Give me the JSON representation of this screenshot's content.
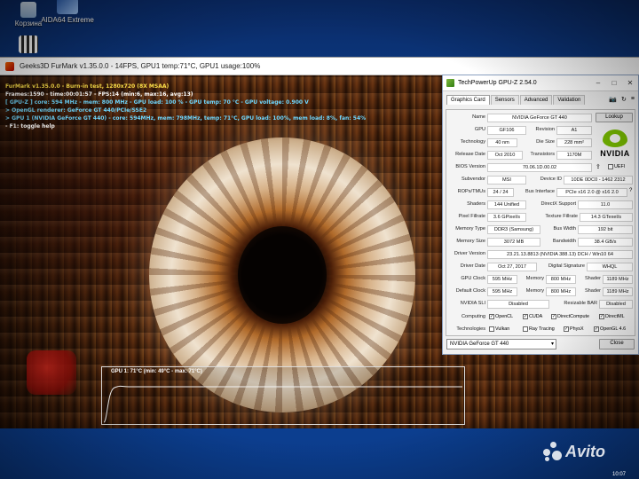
{
  "desktop": {
    "icons": [
      {
        "label": "Корзина"
      },
      {
        "label": "AIDA64 Extreme"
      },
      {
        "label": ""
      }
    ],
    "clock": "10:07"
  },
  "furmark": {
    "window_title": "Geeks3D FurMark v1.35.0.0 - 14FPS, GPU1 temp:71°C, GPU1 usage:100%",
    "osd_lines": [
      {
        "text": "FurMark v1.35.0.0 - Burn-in test, 1280x720 (8X MSAA)",
        "color": "yellow"
      },
      {
        "text": "Frames:1590 - time:00:01:57 - FPS:14 (min:6, max:16, avg:13)",
        "color": "white"
      },
      {
        "text": "[ GPU-Z ] core: 594 MHz - mem: 800 MHz - GPU load: 100 % - GPU temp: 70 °C - GPU voltage: 0.900 V",
        "color": "cyan"
      },
      {
        "text": "> OpenGL renderer: GeForce GT 440/PCIe/SSE2",
        "color": "cyan"
      },
      {
        "text": "> GPU 1 (NVIDIA GeForce GT 440) - core: 594MHz, mem: 798MHz, temp: 71°C, GPU load: 100%, mem load: 8%, fan: 54%",
        "color": "cyan"
      },
      {
        "text": "- F1: toggle help",
        "color": "white"
      }
    ],
    "temp_graph": {
      "label": "GPU 1: 71°C (min: 49°C - max: 71°C)",
      "min": 49,
      "max": 71,
      "current": 71
    }
  },
  "gpuz": {
    "title": "TechPowerUp GPU-Z 2.54.0",
    "tabs": [
      "Graphics Card",
      "Sensors",
      "Advanced",
      "Validation"
    ],
    "lookup_label": "Lookup",
    "vendor_logo": "NVIDIA",
    "uefi_label": "UEFI",
    "fields": {
      "name": {
        "label": "Name",
        "value": "NVIDIA GeForce GT 440"
      },
      "gpu": {
        "label": "GPU",
        "value": "GF106"
      },
      "revision": {
        "label": "Revision",
        "value": "A1"
      },
      "technology": {
        "label": "Technology",
        "value": "40 nm"
      },
      "die_size": {
        "label": "Die Size",
        "value": "228 mm²"
      },
      "release_date": {
        "label": "Release Date",
        "value": "Oct 2010"
      },
      "transistors": {
        "label": "Transistors",
        "value": "1170M"
      },
      "bios_version": {
        "label": "BIOS Version",
        "value": "70.06.1D.00.02"
      },
      "subvendor": {
        "label": "Subvendor",
        "value": "MSI"
      },
      "device_id": {
        "label": "Device ID",
        "value": "10DE 0DC0 - 1462 2312"
      },
      "rops_tmus": {
        "label": "ROPs/TMUs",
        "value": "24 / 24"
      },
      "bus_interface": {
        "label": "Bus Interface",
        "value": "PCIe x16 2.0 @ x16 2.0"
      },
      "shaders": {
        "label": "Shaders",
        "value": "144 Unified"
      },
      "directx_support": {
        "label": "DirectX Support",
        "value": "11.0"
      },
      "pixel_fillrate": {
        "label": "Pixel Fillrate",
        "value": "3.6 GPixel/s"
      },
      "texture_fillrate": {
        "label": "Texture Fillrate",
        "value": "14.3 GTexel/s"
      },
      "memory_type": {
        "label": "Memory Type",
        "value": "DDR3 (Samsung)"
      },
      "bus_width": {
        "label": "Bus Width",
        "value": "192 bit"
      },
      "memory_size": {
        "label": "Memory Size",
        "value": "3072 MB"
      },
      "bandwidth": {
        "label": "Bandwidth",
        "value": "38.4 GB/s"
      },
      "driver_version": {
        "label": "Driver Version",
        "value": "23.21.13.8813 (NVIDIA 388.13) DCH / Win10 64"
      },
      "driver_date": {
        "label": "Driver Date",
        "value": "Oct 27, 2017"
      },
      "digital_signature": {
        "label": "Digital Signature",
        "value": "WHQL"
      },
      "gpu_clock": {
        "label": "GPU Clock",
        "value": "595 MHz"
      },
      "memory_clock": {
        "label": "Memory",
        "value": "800 MHz"
      },
      "shader_clock": {
        "label": "Shader",
        "value": "1189 MHz"
      },
      "default_clock": {
        "label": "Default Clock",
        "value": "595 MHz"
      },
      "default_memory": {
        "label": "Memory",
        "value": "800 MHz"
      },
      "default_shader": {
        "label": "Shader",
        "value": "1189 MHz"
      },
      "nvidia_sli": {
        "label": "NVIDIA SLI",
        "value": "Disabled"
      },
      "resizable_bar": {
        "label": "Resizable BAR",
        "value": "Disabled"
      }
    },
    "computing": {
      "label": "Computing",
      "items": [
        {
          "name": "OpenCL",
          "checked": true
        },
        {
          "name": "CUDA",
          "checked": true
        },
        {
          "name": "DirectCompute",
          "checked": true
        },
        {
          "name": "DirectML",
          "checked": true
        }
      ]
    },
    "technologies": {
      "label": "Technologies",
      "items": [
        {
          "name": "Vulkan",
          "checked": false
        },
        {
          "name": "Ray Tracing",
          "checked": false
        },
        {
          "name": "PhysX",
          "checked": true
        },
        {
          "name": "OpenGL 4.6",
          "checked": true
        }
      ]
    },
    "device_select": "NVIDIA GeForce GT 440",
    "close_label": "Close"
  },
  "watermark": "Avito",
  "colors": {
    "nvidia_green": "#76b900",
    "osd_yellow": "#ffe24a",
    "osd_cyan": "#6fd8ff"
  }
}
